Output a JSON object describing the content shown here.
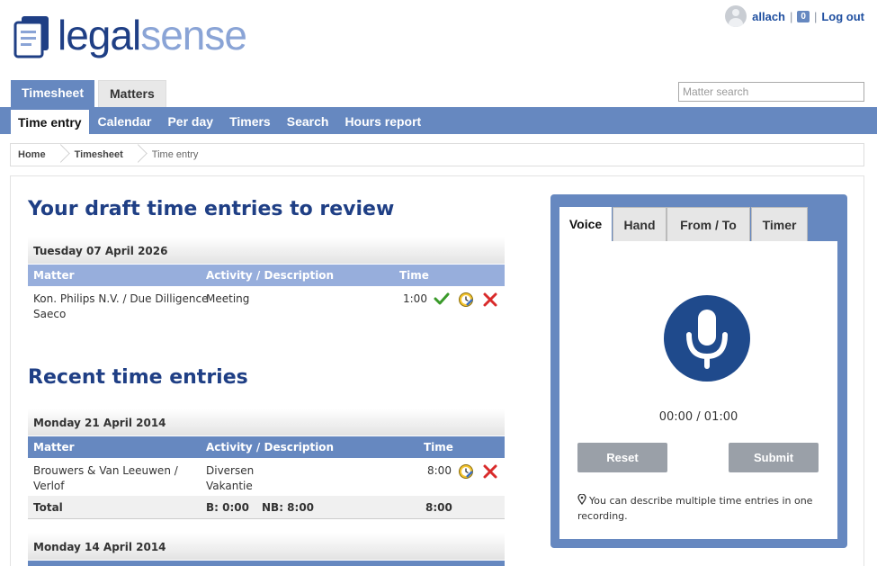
{
  "header": {
    "logo_part1": "legal",
    "logo_part2": "sense",
    "username": "allach",
    "notification_count": "0",
    "logout_label": "Log out",
    "icons": {
      "avatar": "user-avatar-icon"
    }
  },
  "top_tabs": [
    {
      "label": "Timesheet",
      "active": true
    },
    {
      "label": "Matters",
      "active": false
    }
  ],
  "search": {
    "placeholder": "Matter search",
    "value": ""
  },
  "nav": [
    {
      "label": "Time entry",
      "active": true
    },
    {
      "label": "Calendar"
    },
    {
      "label": "Per day"
    },
    {
      "label": "Timers"
    },
    {
      "label": "Search"
    },
    {
      "label": "Hours report"
    }
  ],
  "breadcrumb": [
    "Home",
    "Timesheet",
    "Time entry"
  ],
  "draft": {
    "title": "Your draft time entries to review",
    "day": "Tuesday 07 April 2026",
    "columns": {
      "matter": "Matter",
      "activity": "Activity / Description",
      "time": "Time"
    },
    "rows": [
      {
        "matter_line1": "Kon. Philips N.V. / Due Dilligence",
        "matter_line2": "Saeco",
        "activity": "Meeting",
        "time": "1:00"
      }
    ]
  },
  "recent": {
    "title": "Recent time entries",
    "days": [
      {
        "day": "Monday 21 April 2014",
        "columns": {
          "matter": "Matter",
          "activity": "Activity / Description",
          "time": "Time"
        },
        "rows": [
          {
            "matter_line1": "Brouwers & Van Leeuwen /",
            "matter_line2": "Verlof",
            "activity_line1": "Diversen",
            "activity_line2": "Vakantie",
            "time": "8:00"
          }
        ],
        "total": {
          "label": "Total",
          "billable": "B: 0:00",
          "nonbillable": "NB: 8:00",
          "time": "8:00"
        }
      },
      {
        "day": "Monday 14 April 2014"
      }
    ]
  },
  "voice_panel": {
    "tabs": [
      {
        "label": "Voice",
        "active": true
      },
      {
        "label": "Hand"
      },
      {
        "label": "From / To"
      },
      {
        "label": "Timer"
      }
    ],
    "timer": "00:00 / 01:00",
    "reset_label": "Reset",
    "submit_label": "Submit",
    "hint": "You can describe multiple time entries in one recording."
  },
  "colors": {
    "brand_dark": "#1f3f85",
    "brand_light": "#8aa4d6",
    "nav_blue": "#6688c0",
    "header_light_blue": "#97aedc",
    "mic_blue": "#1f4a8c",
    "button_gray": "#9aa0a8"
  }
}
